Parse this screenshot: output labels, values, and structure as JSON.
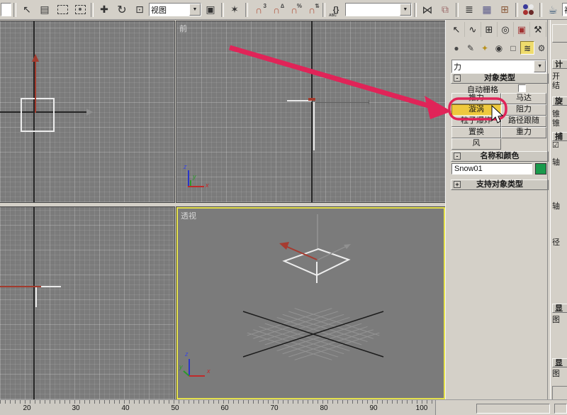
{
  "toolbar": {
    "icons": [
      {
        "name": "select-icon",
        "glyph": "↖"
      },
      {
        "name": "select-by-name-icon",
        "glyph": "▤"
      },
      {
        "name": "move-icon",
        "glyph": "✚"
      },
      {
        "name": "rotate-icon",
        "glyph": "↻"
      },
      {
        "name": "scale-icon",
        "glyph": "⊡"
      },
      {
        "name": "use-pivot-center-icon",
        "glyph": "▣"
      },
      {
        "name": "select-manipulate-icon",
        "glyph": "✶"
      },
      {
        "name": "snap-3d-icon",
        "glyph": "∩",
        "sup": "3"
      },
      {
        "name": "angle-snap-icon",
        "glyph": "∩",
        "sup": "∆"
      },
      {
        "name": "percent-snap-icon",
        "glyph": "∩",
        "sup": "%"
      },
      {
        "name": "spinner-snap-icon",
        "glyph": "∩",
        "sup": "⇅"
      },
      {
        "name": "named-selection-sets-icon",
        "glyph": "{}",
        "sub": "ABC"
      },
      {
        "name": "mirror-icon",
        "glyph": "⋈"
      },
      {
        "name": "align-icon",
        "glyph": "⧉"
      },
      {
        "name": "layer-manager-icon",
        "glyph": "≣"
      },
      {
        "name": "curve-editor-icon",
        "glyph": "▦"
      },
      {
        "name": "schematic-view-icon",
        "glyph": "⊞"
      },
      {
        "name": "render-setup-icon",
        "glyph": "☕"
      },
      {
        "name": "render-icon",
        "glyph": "☕"
      }
    ],
    "view_dropdown_1": {
      "value": "视图"
    },
    "named_selection_dropdown": {
      "value": ""
    },
    "view_dropdown_2": {
      "value": "视图"
    }
  },
  "viewports": {
    "front": {
      "label": "前"
    },
    "perspective": {
      "label": "透视"
    },
    "axis": {
      "x": "x",
      "y": "y",
      "z": "z"
    }
  },
  "command_panel": {
    "tabs": [
      {
        "name": "create",
        "glyph": "↖"
      },
      {
        "name": "modify",
        "glyph": "∿"
      },
      {
        "name": "hierarchy",
        "glyph": "⊞"
      },
      {
        "name": "motion",
        "glyph": "◎"
      },
      {
        "name": "display",
        "glyph": "▣"
      },
      {
        "name": "utilities",
        "glyph": "⚒"
      }
    ],
    "categories": [
      {
        "name": "geometry",
        "glyph": "●"
      },
      {
        "name": "shapes",
        "glyph": "✎"
      },
      {
        "name": "lights",
        "glyph": "✦"
      },
      {
        "name": "cameras",
        "glyph": "◉"
      },
      {
        "name": "helpers",
        "glyph": "□"
      },
      {
        "name": "space-warps",
        "glyph": "≋",
        "active": true
      },
      {
        "name": "systems",
        "glyph": "⚙"
      }
    ],
    "category_dropdown": {
      "value": "力"
    },
    "object_type": {
      "header": "对象类型",
      "minus_glyph": "-",
      "autogrid": {
        "label": "自动栅格",
        "checked": false
      },
      "buttons": [
        {
          "label": "推力",
          "active": false
        },
        {
          "label": "马达",
          "active": false
        },
        {
          "label": "漩涡",
          "active": true
        },
        {
          "label": "阻力",
          "active": false
        },
        {
          "label": "粒子爆炸",
          "active": false
        },
        {
          "label": "路径跟随",
          "active": false
        },
        {
          "label": "置换",
          "active": false
        },
        {
          "label": "重力",
          "active": false
        },
        {
          "label": "风",
          "active": false
        }
      ]
    },
    "name_color": {
      "header": "名称和颜色",
      "minus_glyph": "-",
      "name_value": "Snow01",
      "swatch_color": "#1a9a4c"
    },
    "supports": {
      "header": "支持对象类型",
      "plus_glyph": "+"
    },
    "partial_rollouts": {
      "items": [
        {
          "text": "计"
        },
        {
          "text": "开"
        },
        {
          "text": "结"
        },
        {
          "text": "旋"
        },
        {
          "text": "锥"
        },
        {
          "text": "锥"
        },
        {
          "text": "捕"
        },
        {
          "text": "☑"
        },
        {
          "text": "轴"
        },
        {
          "text": "轴"
        },
        {
          "text": "径"
        },
        {
          "text": "显"
        },
        {
          "text": "图"
        },
        {
          "text": "显"
        },
        {
          "text": "图"
        }
      ]
    }
  },
  "trackbar": {
    "numbers": [
      "20",
      "30",
      "40",
      "50",
      "60",
      "70",
      "80",
      "90",
      "100"
    ]
  },
  "annotation": {
    "arrow_color": "#e02458"
  },
  "colors": {
    "chrome": "#d4d0c8",
    "viewport_bg": "#7b7b7b",
    "active_viewport_border": "#e5e14d",
    "highlighted_button": "#eec93e",
    "swatch_green": "#1a9a4c",
    "annotation_red": "#e02458"
  }
}
